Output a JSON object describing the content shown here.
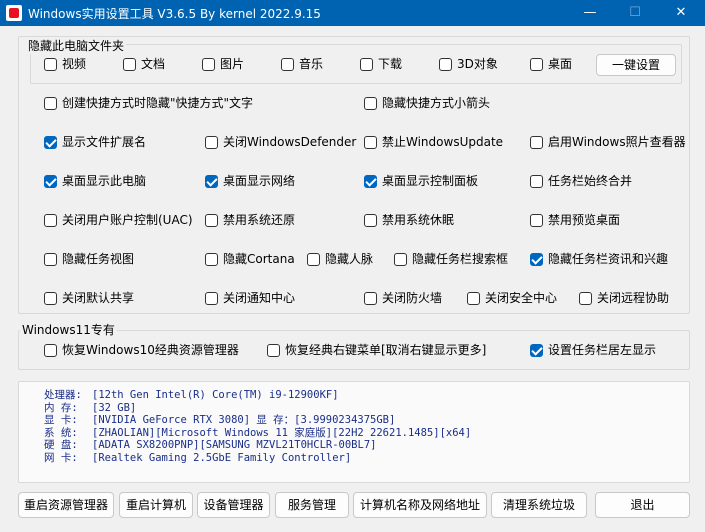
{
  "window": {
    "title": "Windows实用设置工具 V3.6.5 By kernel 2022.9.15",
    "min_glyph": "—",
    "max_glyph": "☐",
    "close_glyph": "✕"
  },
  "hide_folders": {
    "label": "隐藏此电脑文件夹",
    "items": [
      {
        "label": "视频",
        "checked": false
      },
      {
        "label": "文档",
        "checked": false
      },
      {
        "label": "图片",
        "checked": false
      },
      {
        "label": "音乐",
        "checked": false
      },
      {
        "label": "下载",
        "checked": false
      },
      {
        "label": "3D对象",
        "checked": false
      },
      {
        "label": "桌面",
        "checked": false
      }
    ],
    "one_click_button": "一键设置"
  },
  "options": [
    {
      "label": "创建快捷方式时隐藏\"快捷方式\"文字",
      "checked": false
    },
    {
      "label": "隐藏快捷方式小箭头",
      "checked": false
    },
    {
      "label": "显示文件扩展名",
      "checked": true
    },
    {
      "label": "关闭WindowsDefender",
      "checked": false
    },
    {
      "label": "禁止WindowsUpdate",
      "checked": false
    },
    {
      "label": "启用Windows照片查看器",
      "checked": false
    },
    {
      "label": "桌面显示此电脑",
      "checked": true
    },
    {
      "label": "桌面显示网络",
      "checked": true
    },
    {
      "label": "桌面显示控制面板",
      "checked": true
    },
    {
      "label": "任务栏始终合并",
      "checked": false
    },
    {
      "label": "关闭用户账户控制(UAC)",
      "checked": false
    },
    {
      "label": "禁用系统还原",
      "checked": false
    },
    {
      "label": "禁用系统休眠",
      "checked": false
    },
    {
      "label": "禁用预览桌面",
      "checked": false
    },
    {
      "label": "隐藏任务视图",
      "checked": false
    },
    {
      "label": "隐藏Cortana",
      "checked": false
    },
    {
      "label": "隐藏人脉",
      "checked": false
    },
    {
      "label": "隐藏任务栏搜索框",
      "checked": false
    },
    {
      "label": "隐藏任务栏资讯和兴趣",
      "checked": true
    },
    {
      "label": "关闭默认共享",
      "checked": false
    },
    {
      "label": "关闭通知中心",
      "checked": false
    },
    {
      "label": "关闭防火墙",
      "checked": false
    },
    {
      "label": "关闭安全中心",
      "checked": false
    },
    {
      "label": "关闭远程协助",
      "checked": false
    }
  ],
  "win11": {
    "label": "Windows11专有",
    "items": [
      {
        "label": "恢复Windows10经典资源管理器",
        "checked": false
      },
      {
        "label": "恢复经典右键菜单[取消右键显示更多]",
        "checked": false
      },
      {
        "label": "设置任务栏居左显示",
        "checked": true
      }
    ]
  },
  "system_info": [
    {
      "label": "处理器:",
      "value": "[12th Gen Intel(R) Core(TM) i9-12900KF]"
    },
    {
      "label": "内  存:",
      "value": "[32 GB]"
    },
    {
      "label": "显  卡:",
      "value": "[NVIDIA GeForce RTX 3080]  显 存：[3.9990234375GB]"
    },
    {
      "label": "系  统:",
      "value": "[ZHAOLIAN][Microsoft Windows 11 家庭版][22H2 22621.1485][x64]"
    },
    {
      "label": "硬  盘:",
      "value": "[ADATA SX8200PNP][SAMSUNG MZVL21T0HCLR-00BL7]"
    },
    {
      "label": "网  卡:",
      "value": "[Realtek Gaming 2.5GbE Family Controller]"
    }
  ],
  "buttons": [
    "重启资源管理器",
    "重启计算机",
    "设备管理器",
    "服务管理",
    "计算机名称及网络地址",
    "清理系统垃圾",
    "退出"
  ]
}
